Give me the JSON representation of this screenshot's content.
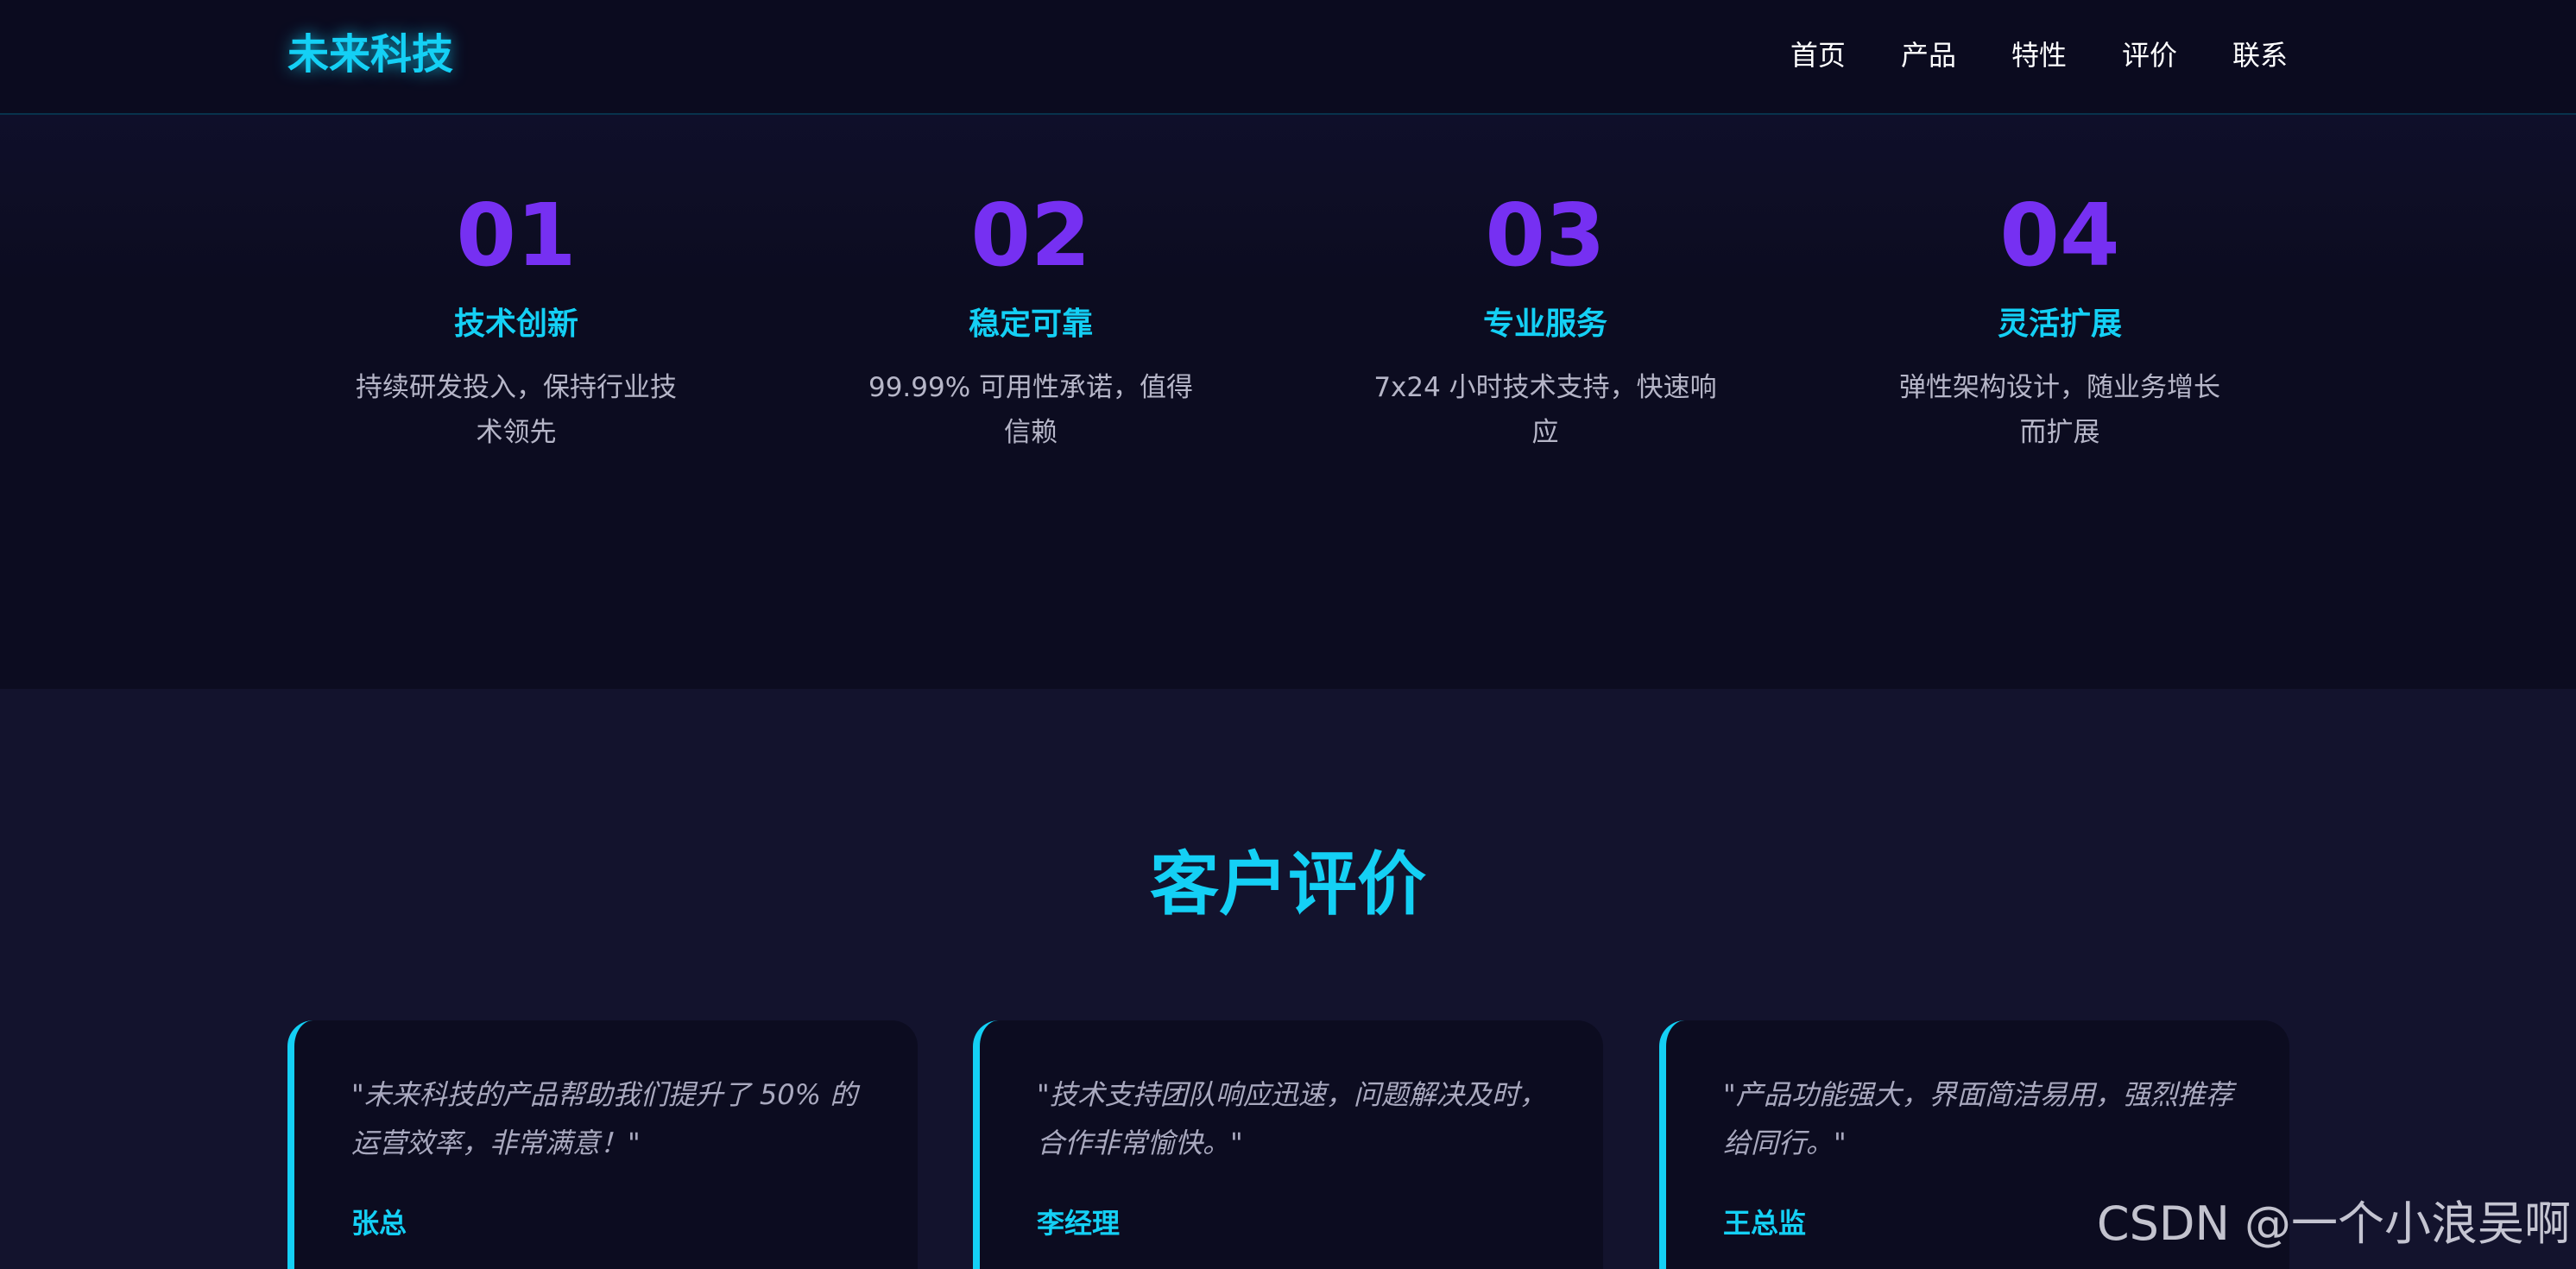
{
  "header": {
    "logo": "未来科技",
    "nav": [
      "首页",
      "产品",
      "特性",
      "评价",
      "联系"
    ]
  },
  "features": [
    {
      "num": "01",
      "title": "技术创新",
      "desc": "持续研发投入，保持行业技术领先"
    },
    {
      "num": "02",
      "title": "稳定可靠",
      "desc": "99.99% 可用性承诺，值得信赖"
    },
    {
      "num": "03",
      "title": "专业服务",
      "desc": "7x24 小时技术支持，快速响应"
    },
    {
      "num": "04",
      "title": "灵活扩展",
      "desc": "弹性架构设计，随业务增长而扩展"
    }
  ],
  "testimonials": {
    "title": "客户评价",
    "cards": [
      {
        "quote": "\"未来科技的产品帮助我们提升了 50% 的运营效率，非常满意！\"",
        "author": "张总"
      },
      {
        "quote": "\"技术支持团队响应迅速，问题解决及时，合作非常愉快。\"",
        "author": "李经理"
      },
      {
        "quote": "\"产品功能强大，界面简洁易用，强烈推荐给同行。\"",
        "author": "王总监"
      }
    ]
  },
  "watermark": "CSDN @一个小浪吴啊",
  "colors": {
    "accent_cyan": "#14d0f5",
    "accent_purple": "#7630f2",
    "background": "#0c0c1e"
  }
}
